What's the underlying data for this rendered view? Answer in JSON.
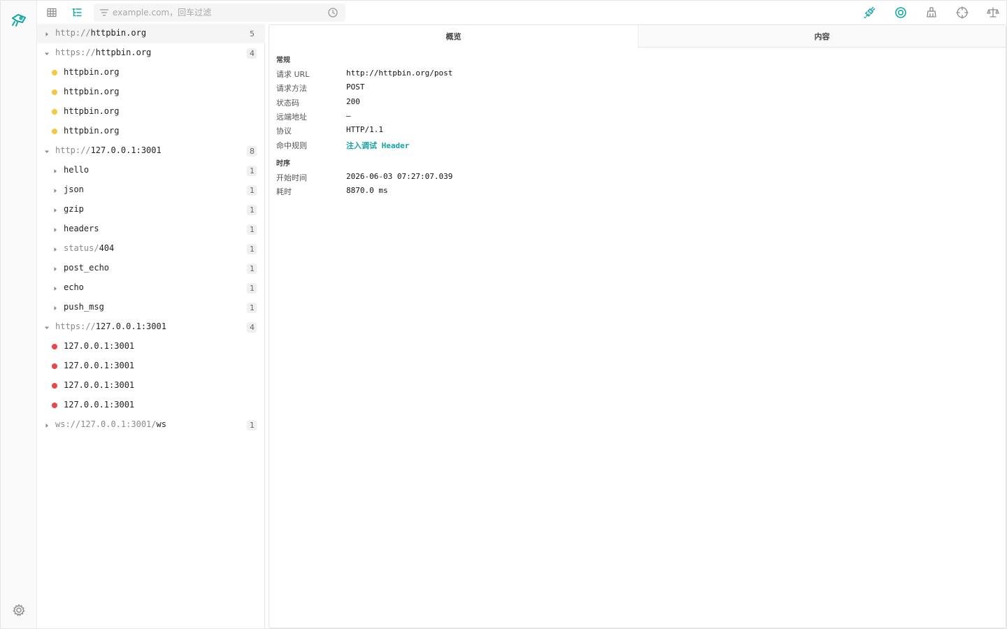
{
  "filter": {
    "placeholder": "example.com，回车过滤"
  },
  "colors": {
    "accent": "#14a6a6",
    "dot_yellow": "#f5c842",
    "dot_red": "#e84848",
    "link": "#16a3a3"
  },
  "rail": {
    "logo_icon": "rocket-icon",
    "settings_icon": "gear-icon"
  },
  "toolbar_icons": [
    "table-view-icon",
    "tree-view-icon",
    "plug-icon",
    "record-icon",
    "broom-icon",
    "crosshair-icon",
    "scale-icon"
  ],
  "tree": [
    {
      "kind": "group",
      "expanded": false,
      "scheme": "http://",
      "host": "httpbin.org",
      "count": "5",
      "selected": true
    },
    {
      "kind": "group",
      "expanded": true,
      "scheme": "https://",
      "host": "httpbin.org",
      "count": "4"
    },
    {
      "kind": "leaf",
      "dot": "yellow",
      "label": "httpbin.org"
    },
    {
      "kind": "leaf",
      "dot": "yellow",
      "label": "httpbin.org"
    },
    {
      "kind": "leaf",
      "dot": "yellow",
      "label": "httpbin.org"
    },
    {
      "kind": "leaf",
      "dot": "yellow",
      "label": "httpbin.org"
    },
    {
      "kind": "group",
      "expanded": true,
      "scheme": "http://",
      "host": "127.0.0.1:3001",
      "count": "8"
    },
    {
      "kind": "path",
      "prefix": "",
      "label": "hello",
      "count": "1"
    },
    {
      "kind": "path",
      "prefix": "",
      "label": "json",
      "count": "1"
    },
    {
      "kind": "path",
      "prefix": "",
      "label": "gzip",
      "count": "1"
    },
    {
      "kind": "path",
      "prefix": "",
      "label": "headers",
      "count": "1"
    },
    {
      "kind": "path",
      "prefix": "status/",
      "label": "404",
      "count": "1"
    },
    {
      "kind": "path",
      "prefix": "",
      "label": "post_echo",
      "count": "1"
    },
    {
      "kind": "path",
      "prefix": "",
      "label": "echo",
      "count": "1"
    },
    {
      "kind": "path",
      "prefix": "",
      "label": "push_msg",
      "count": "1"
    },
    {
      "kind": "group",
      "expanded": true,
      "scheme": "https://",
      "host": "127.0.0.1:3001",
      "count": "4"
    },
    {
      "kind": "leaf",
      "dot": "red",
      "label": "127.0.0.1:3001"
    },
    {
      "kind": "leaf",
      "dot": "red",
      "label": "127.0.0.1:3001"
    },
    {
      "kind": "leaf",
      "dot": "red",
      "label": "127.0.0.1:3001"
    },
    {
      "kind": "leaf",
      "dot": "red",
      "label": "127.0.0.1:3001"
    },
    {
      "kind": "group",
      "expanded": false,
      "scheme": "ws://",
      "host": "127.0.0.1:3001/ws",
      "host_parts": [
        "127.0.0.1:3001/",
        "ws"
      ],
      "count": "1"
    }
  ],
  "detail": {
    "tabs": {
      "overview": "概览",
      "content": "内容"
    },
    "general": {
      "title": "常规",
      "rows": [
        {
          "key": "请求 URL",
          "value": "http://httpbin.org/post"
        },
        {
          "key": "请求方法",
          "value": "POST"
        },
        {
          "key": "状态码",
          "value": "200"
        },
        {
          "key": "远端地址",
          "value": "–"
        },
        {
          "key": "协议",
          "value": "HTTP/1.1"
        },
        {
          "key": "命中规则",
          "value": "注入调试 Header",
          "link": true
        }
      ]
    },
    "timing": {
      "title": "时序",
      "rows": [
        {
          "key": "开始时间",
          "value": "2026-06-03 07:27:07.039"
        },
        {
          "key": "耗时",
          "value": "8870.0 ms"
        }
      ]
    }
  }
}
